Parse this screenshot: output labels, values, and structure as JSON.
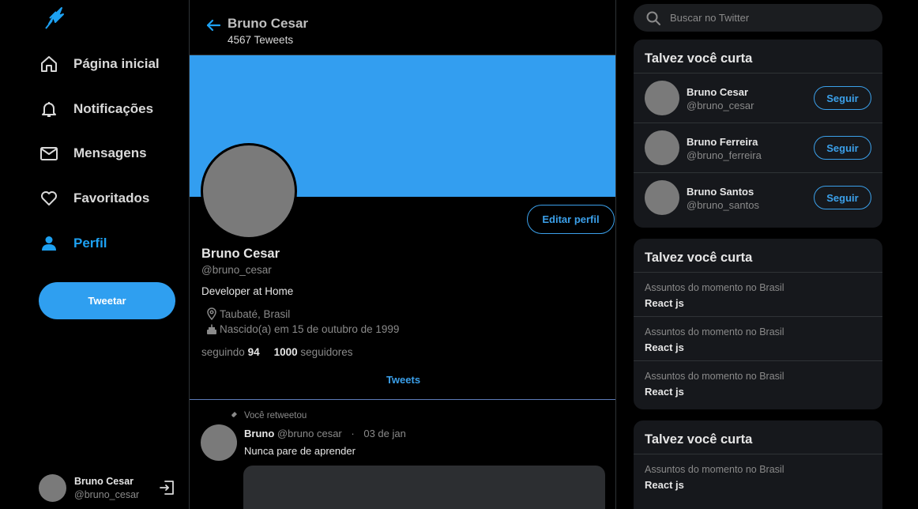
{
  "nav": {
    "items": [
      {
        "label": "Página inicial",
        "icon": "home-icon"
      },
      {
        "label": "Notificações",
        "icon": "bell-icon"
      },
      {
        "label": "Mensagens",
        "icon": "mail-icon"
      },
      {
        "label": "Favoritados",
        "icon": "heart-icon"
      },
      {
        "label": "Perfil",
        "icon": "user-icon",
        "active": true
      }
    ],
    "tweet_button": "Tweetar"
  },
  "account": {
    "name": "Bruno Cesar",
    "handle": "@bruno_cesar"
  },
  "header": {
    "title": "Bruno Cesar",
    "subtitle": "4567 Teweets"
  },
  "profile": {
    "edit_button": "Editar perfil",
    "name": "Bruno Cesar",
    "handle": "@bruno_cesar",
    "bio": "Developer at Home",
    "location": "Taubaté, Brasil",
    "birth": "Nascido(a) em 15 de outubro de 1999",
    "following_label": "seguindo",
    "following_count": "94",
    "followers_count": "1000",
    "followers_label": "seguidores"
  },
  "tabs": {
    "tweets": "Tweets"
  },
  "tweet": {
    "retweet_note": "Você retweetou",
    "author": "Bruno",
    "handle": "@bruno cesar",
    "date": "03 de jan",
    "separator": "·",
    "text": "Nunca pare de aprender"
  },
  "search": {
    "placeholder": "Buscar no Twitter"
  },
  "who_to_follow": {
    "title": "Talvez você curta",
    "follow_label": "Seguir",
    "users": [
      {
        "name": "Bruno Cesar",
        "handle": "@bruno_cesar"
      },
      {
        "name": "Bruno Ferreira",
        "handle": "@bruno_ferreira"
      },
      {
        "name": "Bruno Santos",
        "handle": "@bruno_santos"
      }
    ]
  },
  "trends1": {
    "title": "Talvez você curta",
    "items": [
      {
        "context": "Assuntos do momento no Brasil",
        "topic": "React js"
      },
      {
        "context": "Assuntos do momento no Brasil",
        "topic": "React js"
      },
      {
        "context": "Assuntos do momento no Brasil",
        "topic": "React js"
      }
    ]
  },
  "trends2": {
    "title": "Talvez você curta",
    "items": [
      {
        "context": "Assuntos do momento no Brasil",
        "topic": "React js"
      }
    ]
  },
  "colors": {
    "accent": "#1da1f2",
    "banner": "#339ef0",
    "card": "#16181c"
  }
}
